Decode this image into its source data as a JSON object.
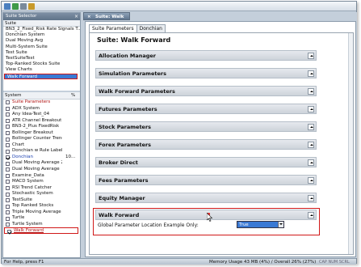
{
  "left_panel": {
    "suite_selector_title": "Suite Selector",
    "suite_column": "Suite",
    "suites": [
      "BN3_2_Fixed_Risk Rate Signals T...",
      "Donchian System",
      "Dual Moving Avg",
      "Multi-System Suite",
      "Test Suite",
      "TestSuiteTest",
      "Top-Ranked Stocks Suite",
      "View Charts",
      "Walk Forward"
    ],
    "system_column": "System",
    "percent_column": "%",
    "systems": [
      {
        "label": "Suite Parameters",
        "pct": "",
        "checked": false
      },
      {
        "label": "ADX System",
        "pct": "",
        "checked": false
      },
      {
        "label": "Any Idea-Test_04",
        "pct": "",
        "checked": false
      },
      {
        "label": "ATR Channel Breakout",
        "pct": "",
        "checked": false
      },
      {
        "label": "BN3-2_Plus FixedRisk",
        "pct": "",
        "checked": false
      },
      {
        "label": "Bollinger Breakout",
        "pct": "",
        "checked": false
      },
      {
        "label": "Bollinger Counter Trend",
        "pct": "",
        "checked": false
      },
      {
        "label": "Chart",
        "pct": "",
        "checked": false
      },
      {
        "label": "Donchian w Rule Labels",
        "pct": "",
        "checked": false
      },
      {
        "label": "Donchian",
        "pct": "10...",
        "checked": true
      },
      {
        "label": "Dual Moving Average 2",
        "pct": "",
        "checked": false
      },
      {
        "label": "Dual Moving Average",
        "pct": "",
        "checked": false
      },
      {
        "label": "Examine_Data",
        "pct": "",
        "checked": false
      },
      {
        "label": "MACD System",
        "pct": "",
        "checked": false
      },
      {
        "label": "RSI Trend Catcher",
        "pct": "",
        "checked": false
      },
      {
        "label": "Stochastic System",
        "pct": "",
        "checked": false
      },
      {
        "label": "TestSuite",
        "pct": "",
        "checked": false
      },
      {
        "label": "Top Ranked Stocks",
        "pct": "",
        "checked": false
      },
      {
        "label": "Triple Moving Average",
        "pct": "",
        "checked": false
      },
      {
        "label": "Turtle",
        "pct": "",
        "checked": false
      },
      {
        "label": "Turtle System",
        "pct": "",
        "checked": false
      },
      {
        "label": "Walk Forward",
        "pct": "",
        "checked": true
      }
    ]
  },
  "document": {
    "tab_title": "Suite: Walk Forward",
    "subtabs": [
      "Suite Parameters",
      "Donchian"
    ],
    "suite_title": "Suite: Walk Forward",
    "sections": [
      "Allocation Manager",
      "Simulation Parameters",
      "Walk Forward Parameters",
      "Futures Parameters",
      "Stock Parameters",
      "Forex Parameters",
      "Broker Direct",
      "Fees Parameters",
      "Equity Manager",
      "Walk Forward"
    ],
    "wf_param_label": "Global Parameter Location Example Only:",
    "wf_param_value": "True"
  },
  "status_bar": {
    "help": "For Help, press F1",
    "memory": "Memory Usage 43 MB (4%) / Overall 26% (27%)",
    "indicators": "CAP NUM SCRL"
  },
  "colors": {
    "selection": "#3a79d4",
    "highlight_box": "#d01818",
    "panel_header": "#60768f"
  }
}
